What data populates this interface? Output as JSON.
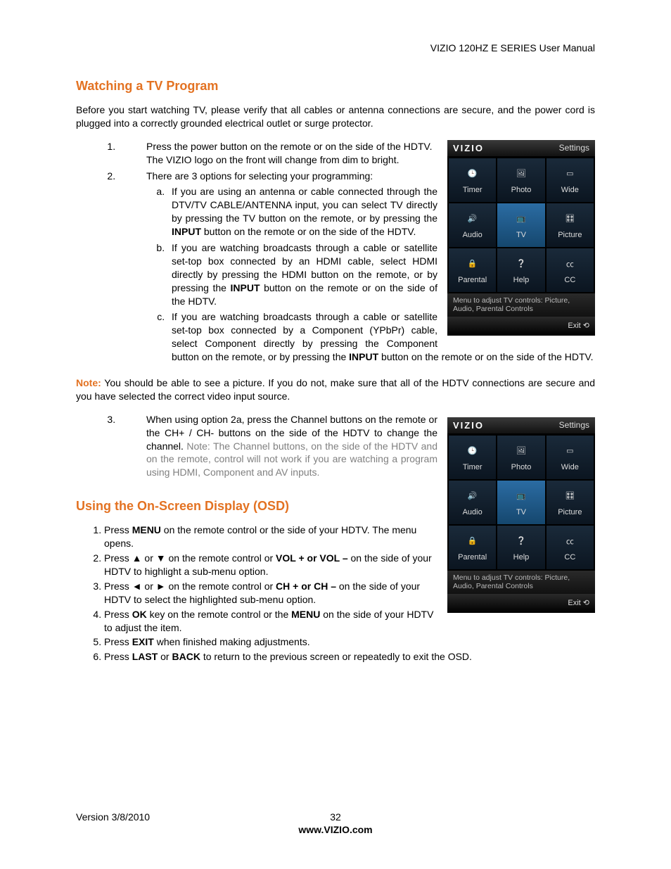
{
  "header": {
    "title": "VIZIO 120HZ E SERIES User Manual"
  },
  "section1": {
    "heading": "Watching a TV Program",
    "intro": "Before you start watching TV, please verify that all cables or antenna connections are secure, and the power cord is plugged into a correctly grounded electrical outlet or surge protector.",
    "item1": "Press the power button on the remote or on the side of the HDTV.  The VIZIO logo on the front will change from dim to bright.",
    "item2": "There are 3 options for selecting your programming:",
    "sub_a_pre": "If you are using an antenna or cable connected through the DTV/TV CABLE/ANTENNA input, you can select TV directly by pressing the TV button on the remote, or by pressing the ",
    "input_word": "INPUT",
    "sub_a_post": " button on the remote or on the side of the HDTV.",
    "sub_b_pre": "If you are watching broadcasts through a cable or satellite set-top box connected by an HDMI cable, select HDMI directly by pressing the HDMI button on the remote, or by pressing the ",
    "sub_b_post": " button on the remote or on the side of the HDTV.",
    "sub_c_pre": "If you are watching broadcasts through a cable or satellite set-top box connected by a Component (YPbPr) cable, select Component directly by pressing the Component button on the remote, or by pressing the ",
    "sub_c_post": " button on the remote or on the side of the HDTV.",
    "note_label": "Note:",
    "note_body": " You should be able to see a picture.  If you do not, make sure that all of the HDTV connections are secure and you have selected the correct video input source.",
    "item3_black": "When using option 2a, press the Channel buttons on the remote or the CH+ / CH- buttons on the side of the HDTV to change the channel.  ",
    "item3_gray": "Note: The Channel buttons, on the side of the HDTV and on the remote, control will not work if you are watching a program using HDMI, Component and AV inputs."
  },
  "section2": {
    "heading": "Using the On-Screen Display (OSD)",
    "i1a": "Press ",
    "i1b": "MENU",
    "i1c": " on the remote control or the side of your HDTV. The menu opens.",
    "i2a": "Press ▲ or ▼ on the remote control or ",
    "i2b": "VOL + or VOL –",
    "i2c": " on the side of your HDTV to highlight a sub-menu option.",
    "i3a": "Press ◄ or ► on the remote control or ",
    "i3b": "CH + or CH –",
    "i3c": " on the side of your HDTV to select the highlighted sub-menu option.",
    "i4a": "Press ",
    "i4b": "OK",
    "i4c": " key on the remote control or the ",
    "i4d": "MENU",
    "i4e": " on the side of your HDTV to adjust the item.",
    "i5a": "Press ",
    "i5b": "EXIT",
    "i5c": " when finished making adjustments.",
    "i6a": "Press ",
    "i6b": "LAST",
    "i6c": " or ",
    "i6d": "BACK",
    "i6e": " to return to the previous screen or repeatedly to exit the OSD."
  },
  "panel": {
    "brand": "VIZIO",
    "settings": "Settings",
    "cells": [
      "Timer",
      "Photo",
      "Wide",
      "Audio",
      "TV",
      "Picture",
      "Parental",
      "Help",
      "CC"
    ],
    "hint": "Menu to adjust TV controls: Picture, Audio, Parental Controls",
    "exit": "Exit"
  },
  "footer": {
    "version": "Version 3/8/2010",
    "page": "32",
    "site": "www.VIZIO.com"
  }
}
